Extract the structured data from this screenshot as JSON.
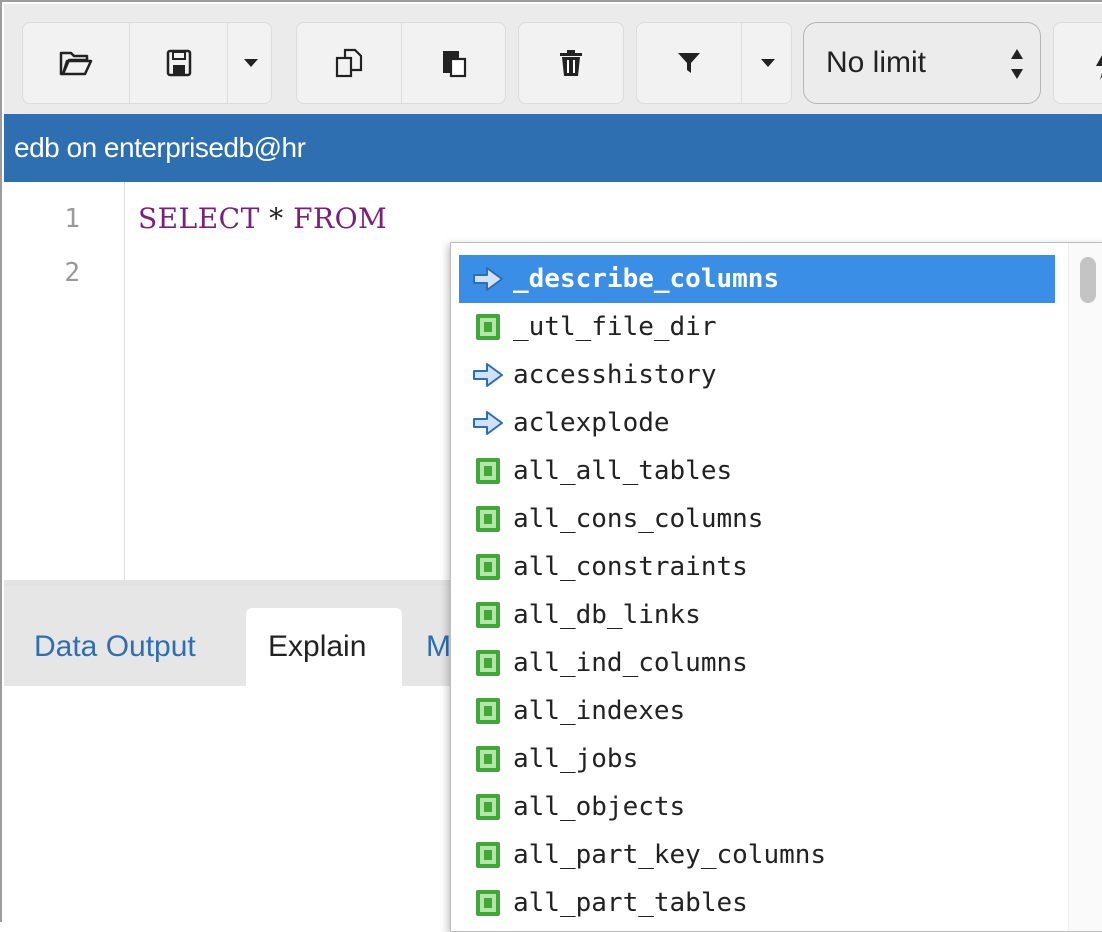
{
  "toolbar": {
    "buttons": [
      {
        "name": "open-file-button",
        "icon": "folder-open-icon"
      },
      {
        "name": "save-file-button",
        "icon": "save-icon"
      },
      {
        "name": "save-dropdown-button",
        "icon": "caret-down-icon"
      },
      {
        "name": "copy-button",
        "icon": "copy-icon"
      },
      {
        "name": "paste-button",
        "icon": "paste-icon"
      },
      {
        "name": "delete-button",
        "icon": "trash-icon"
      },
      {
        "name": "filter-button",
        "icon": "filter-icon"
      },
      {
        "name": "filter-dropdown-button",
        "icon": "caret-down-icon"
      },
      {
        "name": "execute-button",
        "icon": "lightning-icon"
      }
    ],
    "limit_select": {
      "selected": "No limit"
    }
  },
  "titlebar": {
    "connection": "edb on enterprisedb@hr"
  },
  "editor": {
    "line_numbers": [
      "1",
      "2"
    ],
    "line1_keyword1": "SELECT",
    "line1_star": "*",
    "line1_keyword2": "FROM"
  },
  "tabs": {
    "data_output": "Data Output",
    "explain": "Explain",
    "messages_partial": "M"
  },
  "autocomplete": {
    "items": [
      {
        "label": "_describe_columns",
        "type": "function",
        "selected": true
      },
      {
        "label": "_utl_file_dir",
        "type": "table"
      },
      {
        "label": "accesshistory",
        "type": "function"
      },
      {
        "label": "aclexplode",
        "type": "function"
      },
      {
        "label": "all_all_tables",
        "type": "table"
      },
      {
        "label": "all_cons_columns",
        "type": "table"
      },
      {
        "label": "all_constraints",
        "type": "table"
      },
      {
        "label": "all_db_links",
        "type": "table"
      },
      {
        "label": "all_ind_columns",
        "type": "table"
      },
      {
        "label": "all_indexes",
        "type": "table"
      },
      {
        "label": "all_jobs",
        "type": "table"
      },
      {
        "label": "all_objects",
        "type": "table"
      },
      {
        "label": "all_part_key_columns",
        "type": "table"
      },
      {
        "label": "all_part_tables",
        "type": "table"
      }
    ]
  },
  "colors": {
    "accent": "#2d6fb0",
    "selection": "#3a8ee6",
    "keyword": "#7a1f7a"
  }
}
